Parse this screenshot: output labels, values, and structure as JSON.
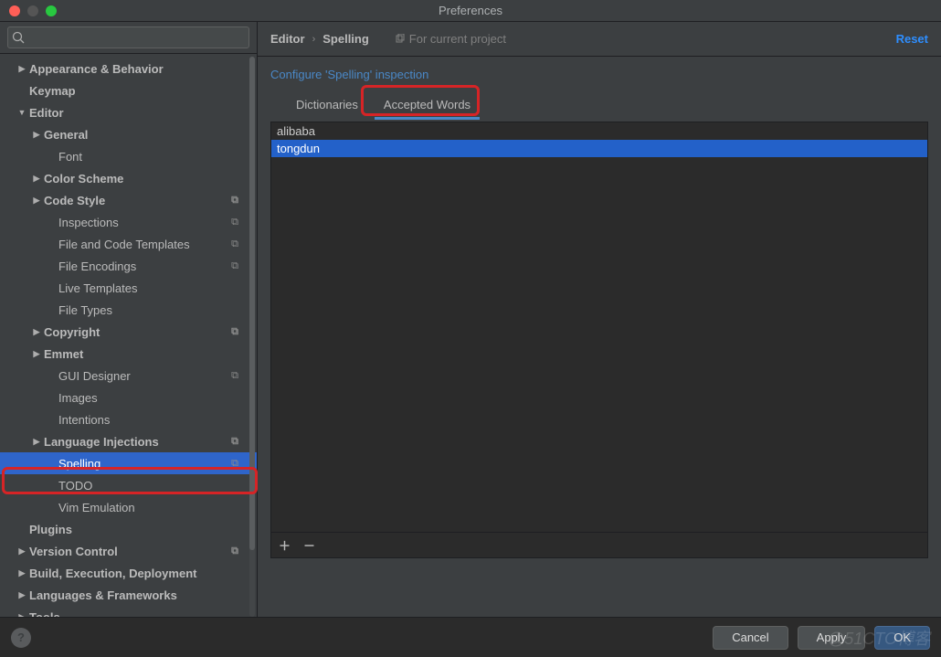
{
  "window": {
    "title": "Preferences"
  },
  "search": {
    "placeholder": ""
  },
  "sidebar": [
    {
      "label": "Appearance & Behavior",
      "indent": 1,
      "arrow": "closed",
      "bold": true
    },
    {
      "label": "Keymap",
      "indent": 1,
      "arrow": "none",
      "bold": true
    },
    {
      "label": "Editor",
      "indent": 1,
      "arrow": "open",
      "bold": true
    },
    {
      "label": "General",
      "indent": 2,
      "arrow": "closed",
      "bold": true
    },
    {
      "label": "Font",
      "indent": 3,
      "arrow": "none",
      "bold": false
    },
    {
      "label": "Color Scheme",
      "indent": 2,
      "arrow": "closed",
      "bold": true
    },
    {
      "label": "Code Style",
      "indent": 2,
      "arrow": "closed",
      "bold": true,
      "copy": true
    },
    {
      "label": "Inspections",
      "indent": 3,
      "arrow": "none",
      "bold": false,
      "copy": true
    },
    {
      "label": "File and Code Templates",
      "indent": 3,
      "arrow": "none",
      "bold": false,
      "copy": true
    },
    {
      "label": "File Encodings",
      "indent": 3,
      "arrow": "none",
      "bold": false,
      "copy": true
    },
    {
      "label": "Live Templates",
      "indent": 3,
      "arrow": "none",
      "bold": false
    },
    {
      "label": "File Types",
      "indent": 3,
      "arrow": "none",
      "bold": false
    },
    {
      "label": "Copyright",
      "indent": 2,
      "arrow": "closed",
      "bold": true,
      "copy": true
    },
    {
      "label": "Emmet",
      "indent": 2,
      "arrow": "closed",
      "bold": true
    },
    {
      "label": "GUI Designer",
      "indent": 3,
      "arrow": "none",
      "bold": false,
      "copy": true
    },
    {
      "label": "Images",
      "indent": 3,
      "arrow": "none",
      "bold": false
    },
    {
      "label": "Intentions",
      "indent": 3,
      "arrow": "none",
      "bold": false
    },
    {
      "label": "Language Injections",
      "indent": 2,
      "arrow": "closed",
      "bold": true,
      "copy": true
    },
    {
      "label": "Spelling",
      "indent": 3,
      "arrow": "none",
      "bold": false,
      "copy": true,
      "selected": true
    },
    {
      "label": "TODO",
      "indent": 3,
      "arrow": "none",
      "bold": false
    },
    {
      "label": "Vim Emulation",
      "indent": 3,
      "arrow": "none",
      "bold": false
    },
    {
      "label": "Plugins",
      "indent": 1,
      "arrow": "none",
      "bold": true
    },
    {
      "label": "Version Control",
      "indent": 1,
      "arrow": "closed",
      "bold": true,
      "copy": true
    },
    {
      "label": "Build, Execution, Deployment",
      "indent": 1,
      "arrow": "closed",
      "bold": true
    },
    {
      "label": "Languages & Frameworks",
      "indent": 1,
      "arrow": "closed",
      "bold": true
    },
    {
      "label": "Tools",
      "indent": 1,
      "arrow": "closed",
      "bold": true
    }
  ],
  "breadcrumb": {
    "a": "Editor",
    "b": "Spelling"
  },
  "project_scope": "For current project",
  "reset": "Reset",
  "configure_link": "Configure 'Spelling' inspection",
  "tabs": [
    {
      "label": "Dictionaries",
      "active": false
    },
    {
      "label": "Accepted Words",
      "active": true
    }
  ],
  "words": [
    {
      "label": "alibaba",
      "selected": false
    },
    {
      "label": "tongdun",
      "selected": true
    }
  ],
  "buttons": {
    "cancel": "Cancel",
    "apply": "Apply",
    "ok": "OK"
  },
  "watermark": "@51CTO博客"
}
